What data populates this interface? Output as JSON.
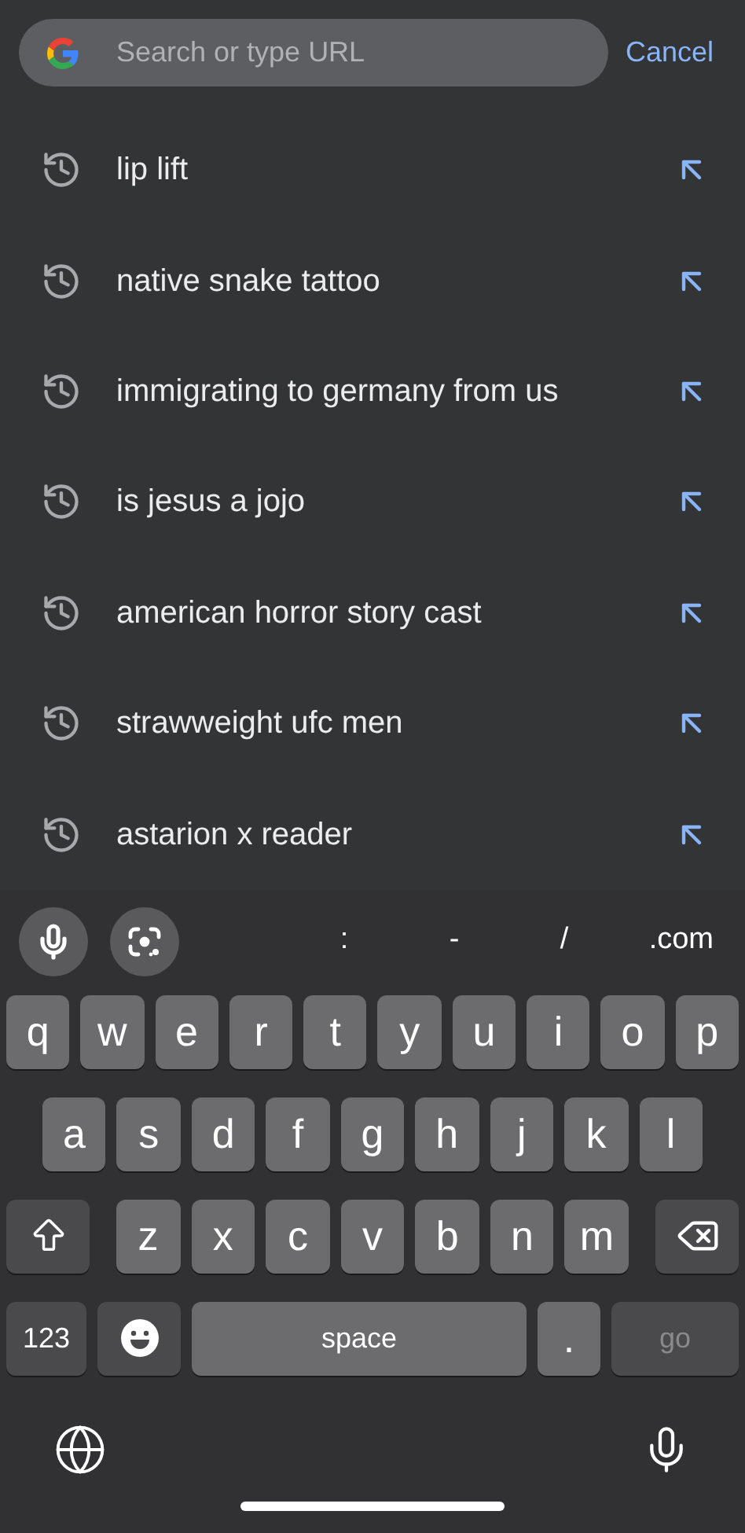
{
  "search_bar": {
    "placeholder": "Search or type URL"
  },
  "cancel": "Cancel",
  "suggestions": [
    {
      "text": "lip lift"
    },
    {
      "text": "native snake tattoo"
    },
    {
      "text": "immigrating to germany from us"
    },
    {
      "text": "is jesus a jojo"
    },
    {
      "text": "american horror story cast"
    },
    {
      "text": "strawweight ufc men"
    },
    {
      "text": "astarion x reader"
    }
  ],
  "keyboard": {
    "shortcuts": [
      ":",
      "-",
      "/",
      ".com"
    ],
    "rows": [
      {
        "keys": [
          {
            "kind": "char",
            "label": "q"
          },
          {
            "kind": "char",
            "label": "w"
          },
          {
            "kind": "char",
            "label": "e"
          },
          {
            "kind": "char",
            "label": "r"
          },
          {
            "kind": "char",
            "label": "t"
          },
          {
            "kind": "char",
            "label": "y"
          },
          {
            "kind": "char",
            "label": "u"
          },
          {
            "kind": "char",
            "label": "i"
          },
          {
            "kind": "char",
            "label": "o"
          },
          {
            "kind": "char",
            "label": "p"
          }
        ]
      },
      {
        "keys": [
          {
            "kind": "char",
            "label": "a"
          },
          {
            "kind": "char",
            "label": "s"
          },
          {
            "kind": "char",
            "label": "d"
          },
          {
            "kind": "char",
            "label": "f"
          },
          {
            "kind": "char",
            "label": "g"
          },
          {
            "kind": "char",
            "label": "h"
          },
          {
            "kind": "char",
            "label": "j"
          },
          {
            "kind": "char",
            "label": "k"
          },
          {
            "kind": "char",
            "label": "l"
          }
        ]
      },
      {
        "keys": [
          {
            "kind": "shift"
          },
          {
            "kind": "char",
            "label": "z"
          },
          {
            "kind": "char",
            "label": "x"
          },
          {
            "kind": "char",
            "label": "c"
          },
          {
            "kind": "char",
            "label": "v"
          },
          {
            "kind": "char",
            "label": "b"
          },
          {
            "kind": "char",
            "label": "n"
          },
          {
            "kind": "char",
            "label": "m"
          },
          {
            "kind": "backspace"
          }
        ]
      },
      {
        "keys": [
          {
            "kind": "mode",
            "label": "123"
          },
          {
            "kind": "emoji"
          },
          {
            "kind": "space",
            "label": "space"
          },
          {
            "kind": "char",
            "label": "."
          },
          {
            "kind": "action",
            "label": "go",
            "disabled": true
          }
        ]
      }
    ]
  }
}
